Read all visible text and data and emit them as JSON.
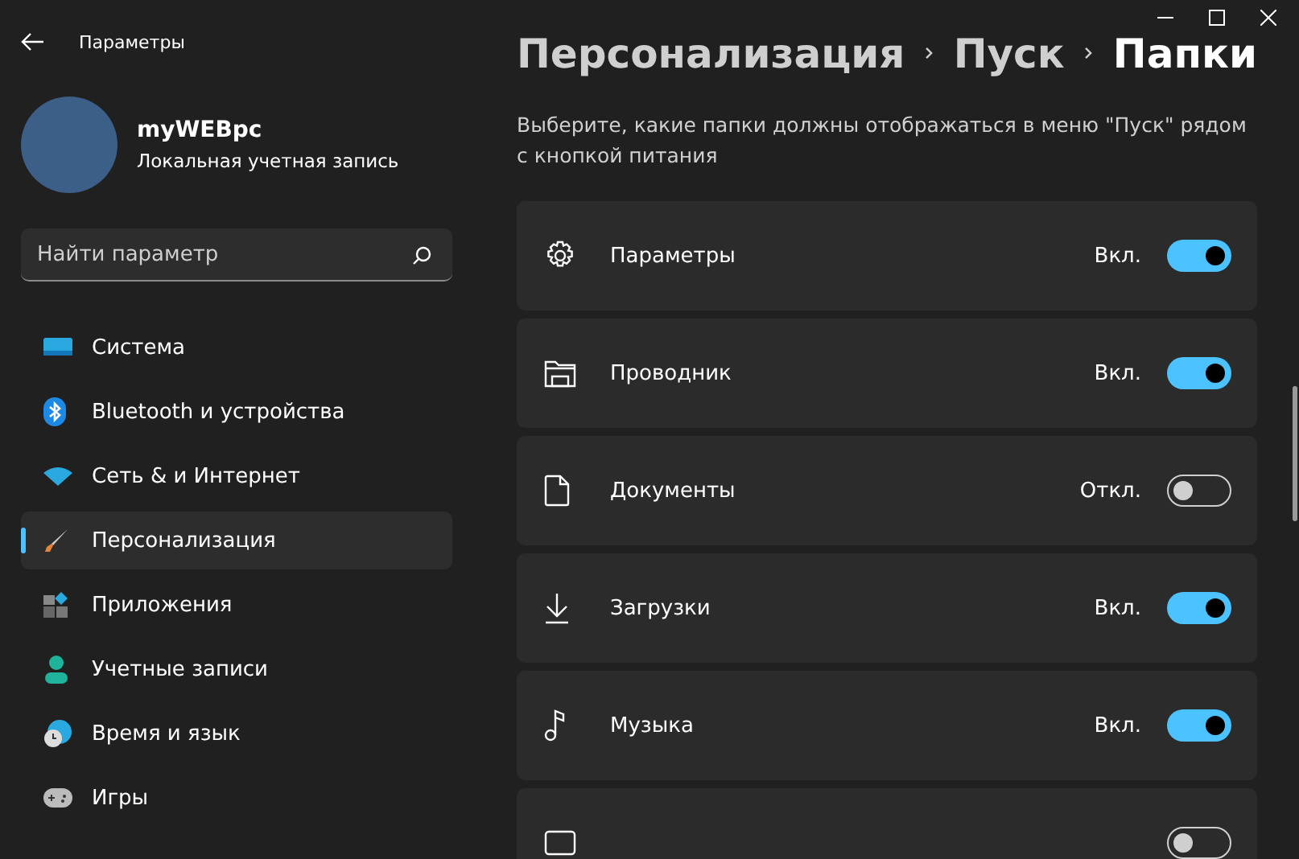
{
  "window": {
    "title": "Параметры"
  },
  "account": {
    "name": "myWEBpc",
    "type": "Локальная учетная запись"
  },
  "search": {
    "placeholder": "Найти параметр"
  },
  "sidebar": {
    "items": [
      {
        "label": "Система",
        "selected": false
      },
      {
        "label": "Bluetooth и устройства",
        "selected": false
      },
      {
        "label": "Сеть & и Интернет",
        "selected": false
      },
      {
        "label": "Персонализация",
        "selected": true
      },
      {
        "label": "Приложения",
        "selected": false
      },
      {
        "label": "Учетные записи",
        "selected": false
      },
      {
        "label": "Время и язык",
        "selected": false
      },
      {
        "label": "Игры",
        "selected": false
      }
    ]
  },
  "breadcrumb": [
    "Персонализация",
    "Пуск",
    "Папки"
  ],
  "description": "Выберите, какие папки должны отображаться в меню \"Пуск\" рядом с кнопкой питания",
  "folders": [
    {
      "label": "Параметры",
      "state_label": "Вкл.",
      "on": true
    },
    {
      "label": "Проводник",
      "state_label": "Вкл.",
      "on": true
    },
    {
      "label": "Документы",
      "state_label": "Откл.",
      "on": false
    },
    {
      "label": "Загрузки",
      "state_label": "Вкл.",
      "on": true
    },
    {
      "label": "Музыка",
      "state_label": "Вкл.",
      "on": true
    },
    {
      "on": false
    }
  ]
}
